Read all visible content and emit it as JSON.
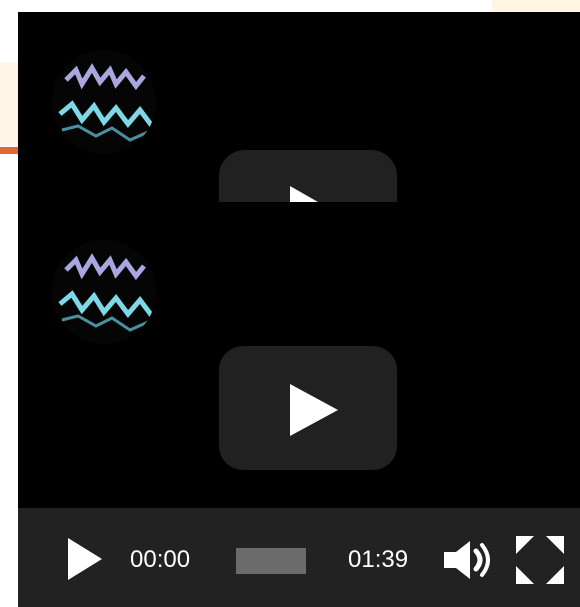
{
  "player": {
    "current_time": "00:00",
    "duration": "01:39",
    "progress_fraction": 0
  },
  "icons": {
    "play": "play-icon",
    "volume": "volume-icon",
    "fullscreen": "fullscreen-icon"
  },
  "colors": {
    "video_background": "#000000",
    "control_bar": "#222222",
    "play_button": "#212121",
    "accent": "#e06a34"
  }
}
